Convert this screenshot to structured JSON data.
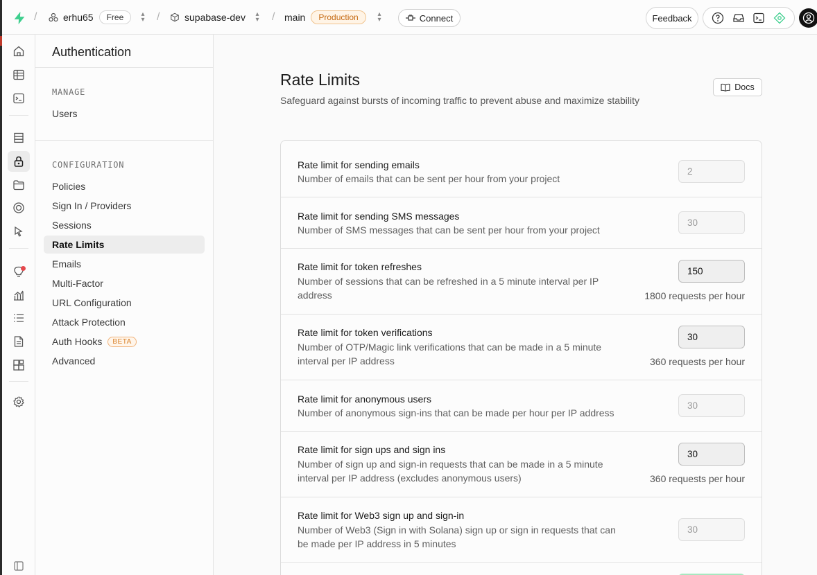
{
  "topbar": {
    "org": "erhu65",
    "plan": "Free",
    "project": "supabase-dev",
    "branch": "main",
    "env": "Production",
    "connect": "Connect",
    "feedback": "Feedback"
  },
  "sidebar": {
    "title": "Authentication",
    "manage_heading": "MANAGE",
    "manage_items": [
      "Users"
    ],
    "config_heading": "CONFIGURATION",
    "config_items": [
      "Policies",
      "Sign In / Providers",
      "Sessions",
      "Rate Limits",
      "Emails",
      "Multi-Factor",
      "URL Configuration",
      "Attack Protection",
      "Auth Hooks",
      "Advanced"
    ],
    "beta_badge": "BETA",
    "active_item": "Rate Limits"
  },
  "page": {
    "title": "Rate Limits",
    "subtitle": "Safeguard against bursts of incoming traffic to prevent abuse and maximize stability",
    "docs": "Docs"
  },
  "limits": [
    {
      "label": "Rate limit for sending emails",
      "desc": "Number of emails that can be sent per hour from your project",
      "value": "2",
      "editable": false,
      "note": ""
    },
    {
      "label": "Rate limit for sending SMS messages",
      "desc": "Number of SMS messages that can be sent per hour from your project",
      "value": "30",
      "editable": false,
      "note": ""
    },
    {
      "label": "Rate limit for token refreshes",
      "desc": "Number of sessions that can be refreshed in a 5 minute interval per IP address",
      "value": "150",
      "editable": true,
      "note": "1800 requests per hour"
    },
    {
      "label": "Rate limit for token verifications",
      "desc": "Number of OTP/Magic link verifications that can be made in a 5 minute interval per IP address",
      "value": "30",
      "editable": true,
      "note": "360 requests per hour"
    },
    {
      "label": "Rate limit for anonymous users",
      "desc": "Number of anonymous sign-ins that can be made per hour per IP address",
      "value": "30",
      "editable": false,
      "note": ""
    },
    {
      "label": "Rate limit for sign ups and sign ins",
      "desc": "Number of sign up and sign-in requests that can be made in a 5 minute interval per IP address (excludes anonymous users)",
      "value": "30",
      "editable": true,
      "note": "360 requests per hour"
    },
    {
      "label": "Rate limit for Web3 sign up and sign-in",
      "desc": "Number of Web3 (Sign in with Solana) sign up or sign in requests that can be made per IP address in 5 minutes",
      "value": "30",
      "editable": false,
      "note": ""
    }
  ],
  "colors": {
    "brand": "#3ecf8e",
    "production": "#c56a12",
    "beta": "#d9822b",
    "notification": "#e5484d"
  }
}
